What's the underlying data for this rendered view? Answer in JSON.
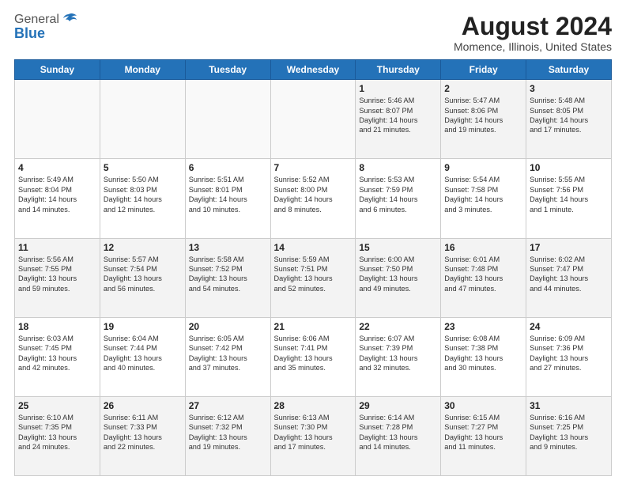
{
  "header": {
    "logo_general": "General",
    "logo_blue": "Blue",
    "title": "August 2024",
    "subtitle": "Momence, Illinois, United States"
  },
  "calendar": {
    "days_of_week": [
      "Sunday",
      "Monday",
      "Tuesday",
      "Wednesday",
      "Thursday",
      "Friday",
      "Saturday"
    ],
    "weeks": [
      [
        {
          "day": "",
          "info": ""
        },
        {
          "day": "",
          "info": ""
        },
        {
          "day": "",
          "info": ""
        },
        {
          "day": "",
          "info": ""
        },
        {
          "day": "1",
          "info": "Sunrise: 5:46 AM\nSunset: 8:07 PM\nDaylight: 14 hours\nand 21 minutes."
        },
        {
          "day": "2",
          "info": "Sunrise: 5:47 AM\nSunset: 8:06 PM\nDaylight: 14 hours\nand 19 minutes."
        },
        {
          "day": "3",
          "info": "Sunrise: 5:48 AM\nSunset: 8:05 PM\nDaylight: 14 hours\nand 17 minutes."
        }
      ],
      [
        {
          "day": "4",
          "info": "Sunrise: 5:49 AM\nSunset: 8:04 PM\nDaylight: 14 hours\nand 14 minutes."
        },
        {
          "day": "5",
          "info": "Sunrise: 5:50 AM\nSunset: 8:03 PM\nDaylight: 14 hours\nand 12 minutes."
        },
        {
          "day": "6",
          "info": "Sunrise: 5:51 AM\nSunset: 8:01 PM\nDaylight: 14 hours\nand 10 minutes."
        },
        {
          "day": "7",
          "info": "Sunrise: 5:52 AM\nSunset: 8:00 PM\nDaylight: 14 hours\nand 8 minutes."
        },
        {
          "day": "8",
          "info": "Sunrise: 5:53 AM\nSunset: 7:59 PM\nDaylight: 14 hours\nand 6 minutes."
        },
        {
          "day": "9",
          "info": "Sunrise: 5:54 AM\nSunset: 7:58 PM\nDaylight: 14 hours\nand 3 minutes."
        },
        {
          "day": "10",
          "info": "Sunrise: 5:55 AM\nSunset: 7:56 PM\nDaylight: 14 hours\nand 1 minute."
        }
      ],
      [
        {
          "day": "11",
          "info": "Sunrise: 5:56 AM\nSunset: 7:55 PM\nDaylight: 13 hours\nand 59 minutes."
        },
        {
          "day": "12",
          "info": "Sunrise: 5:57 AM\nSunset: 7:54 PM\nDaylight: 13 hours\nand 56 minutes."
        },
        {
          "day": "13",
          "info": "Sunrise: 5:58 AM\nSunset: 7:52 PM\nDaylight: 13 hours\nand 54 minutes."
        },
        {
          "day": "14",
          "info": "Sunrise: 5:59 AM\nSunset: 7:51 PM\nDaylight: 13 hours\nand 52 minutes."
        },
        {
          "day": "15",
          "info": "Sunrise: 6:00 AM\nSunset: 7:50 PM\nDaylight: 13 hours\nand 49 minutes."
        },
        {
          "day": "16",
          "info": "Sunrise: 6:01 AM\nSunset: 7:48 PM\nDaylight: 13 hours\nand 47 minutes."
        },
        {
          "day": "17",
          "info": "Sunrise: 6:02 AM\nSunset: 7:47 PM\nDaylight: 13 hours\nand 44 minutes."
        }
      ],
      [
        {
          "day": "18",
          "info": "Sunrise: 6:03 AM\nSunset: 7:45 PM\nDaylight: 13 hours\nand 42 minutes."
        },
        {
          "day": "19",
          "info": "Sunrise: 6:04 AM\nSunset: 7:44 PM\nDaylight: 13 hours\nand 40 minutes."
        },
        {
          "day": "20",
          "info": "Sunrise: 6:05 AM\nSunset: 7:42 PM\nDaylight: 13 hours\nand 37 minutes."
        },
        {
          "day": "21",
          "info": "Sunrise: 6:06 AM\nSunset: 7:41 PM\nDaylight: 13 hours\nand 35 minutes."
        },
        {
          "day": "22",
          "info": "Sunrise: 6:07 AM\nSunset: 7:39 PM\nDaylight: 13 hours\nand 32 minutes."
        },
        {
          "day": "23",
          "info": "Sunrise: 6:08 AM\nSunset: 7:38 PM\nDaylight: 13 hours\nand 30 minutes."
        },
        {
          "day": "24",
          "info": "Sunrise: 6:09 AM\nSunset: 7:36 PM\nDaylight: 13 hours\nand 27 minutes."
        }
      ],
      [
        {
          "day": "25",
          "info": "Sunrise: 6:10 AM\nSunset: 7:35 PM\nDaylight: 13 hours\nand 24 minutes."
        },
        {
          "day": "26",
          "info": "Sunrise: 6:11 AM\nSunset: 7:33 PM\nDaylight: 13 hours\nand 22 minutes."
        },
        {
          "day": "27",
          "info": "Sunrise: 6:12 AM\nSunset: 7:32 PM\nDaylight: 13 hours\nand 19 minutes."
        },
        {
          "day": "28",
          "info": "Sunrise: 6:13 AM\nSunset: 7:30 PM\nDaylight: 13 hours\nand 17 minutes."
        },
        {
          "day": "29",
          "info": "Sunrise: 6:14 AM\nSunset: 7:28 PM\nDaylight: 13 hours\nand 14 minutes."
        },
        {
          "day": "30",
          "info": "Sunrise: 6:15 AM\nSunset: 7:27 PM\nDaylight: 13 hours\nand 11 minutes."
        },
        {
          "day": "31",
          "info": "Sunrise: 6:16 AM\nSunset: 7:25 PM\nDaylight: 13 hours\nand 9 minutes."
        }
      ]
    ]
  }
}
